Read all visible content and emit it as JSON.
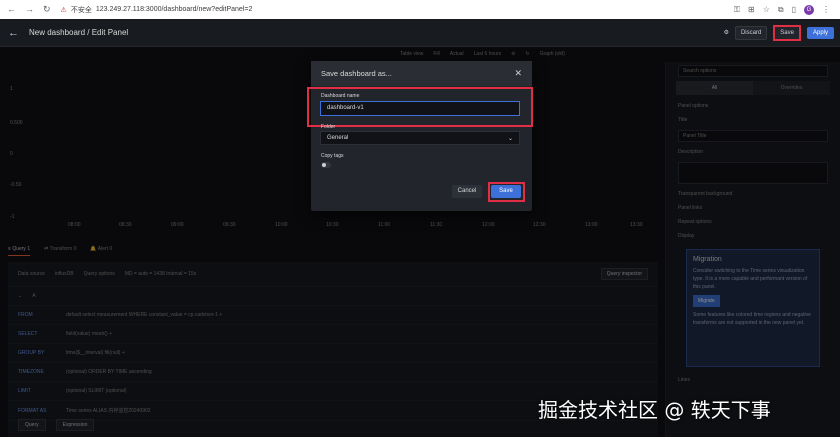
{
  "browser": {
    "insecure_label": "不安全",
    "url": "123.249.27.118:3000/dashboard/new?editPanel=2",
    "avatar_letter": "G"
  },
  "topbar": {
    "title": "New dashboard / Edit Panel",
    "discard_label": "Discard",
    "save_label": "Save",
    "apply_label": "Apply"
  },
  "toolbar2": {
    "table_view": "Table view",
    "fill": "Fill",
    "actual": "Actual",
    "time_range": "Last 6 hours",
    "viz": "Graph (old)"
  },
  "chart": {
    "yticks": [
      "1",
      "0.500",
      "0",
      "-0.50",
      "-1"
    ],
    "xticks": [
      "08:00",
      "08:30",
      "09:00",
      "09:30",
      "10:00",
      "10:30",
      "11:00",
      "11:30",
      "12:00",
      "12:30",
      "13:00",
      "13:30"
    ]
  },
  "query_tabs": {
    "query": "Query",
    "query_count": "1",
    "transform": "Transform",
    "transform_count": "0",
    "alert": "Alert",
    "alert_count": "0"
  },
  "query_panel": {
    "data_source_label": "Data source",
    "data_source": "influxDB",
    "query_options": "Query options",
    "md": "MD = auto = 1438  Interval = 15s",
    "query_inspector": "Query inspector",
    "query_letter": "A",
    "rows": [
      {
        "label": "FROM",
        "value": "default  select measurement  WHERE  constant_value  =  cp.cadvisor-1  +"
      },
      {
        "label": "SELECT",
        "value": "field(value)  mean()  +"
      },
      {
        "label": "GROUP BY",
        "value": "time($__interval)  fill(null)  +"
      },
      {
        "label": "TIMEZONE",
        "value": "(optional)  ORDER BY TIME  ascending"
      },
      {
        "label": "LIMIT",
        "value": "(optional)  SLIMIT  (optional)"
      },
      {
        "label": "FORMAT AS",
        "value": "Time series  ALIAS  内存监控20240902"
      }
    ],
    "add_query": "Query",
    "add_expression": "Expression"
  },
  "right_panel": {
    "search_placeholder": "Search options",
    "tab_all": "All",
    "tab_overrides": "Overrides",
    "panel_options": "Panel options",
    "title_label": "Title",
    "title_value": "Panel Title",
    "description_label": "Description",
    "transparent_label": "Transparent background",
    "panel_links": "Panel links",
    "repeat_options": "Repeat options",
    "display": "Display",
    "migration_title": "Migration",
    "migration_text": "Consider switching to the Time series visualization type. It is a more capable and performant version of this panel.",
    "migrate_button": "Migrate",
    "migration_note": "Some features like colored time regions and negative transforms are not supported in the new panel yet.",
    "lines_label": "Lines"
  },
  "modal": {
    "title": "Save dashboard as...",
    "name_label": "Dashboard name",
    "name_value": "dashboard-v1",
    "folder_label": "Folder",
    "folder_value": "General",
    "copy_tags_label": "Copy tags",
    "cancel_label": "Cancel",
    "save_label": "Save"
  },
  "watermark": "掘金技术社区 @ 轶天下事"
}
